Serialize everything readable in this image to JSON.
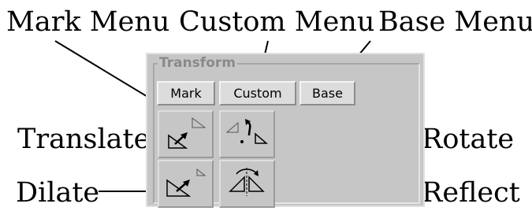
{
  "callouts": {
    "mark_menu": "Mark Menu",
    "custom_menu": "Custom Menu",
    "base_menu": "Base Menu",
    "translate": "Translate",
    "rotate": "Rotate",
    "dilate": "Dilate",
    "reflect": "Reflect"
  },
  "panel": {
    "group_title": "Transform",
    "buttons": {
      "mark": "Mark",
      "custom": "Custom",
      "base": "Base"
    },
    "tools": [
      "translate-icon",
      "rotate-icon",
      "dilate-icon",
      "reflect-icon"
    ]
  },
  "colors": {
    "panel_bg": "#c6c6c6",
    "button_bg": "#dcdcdc",
    "group_title": "#8a8a8a",
    "text": "#000000"
  }
}
